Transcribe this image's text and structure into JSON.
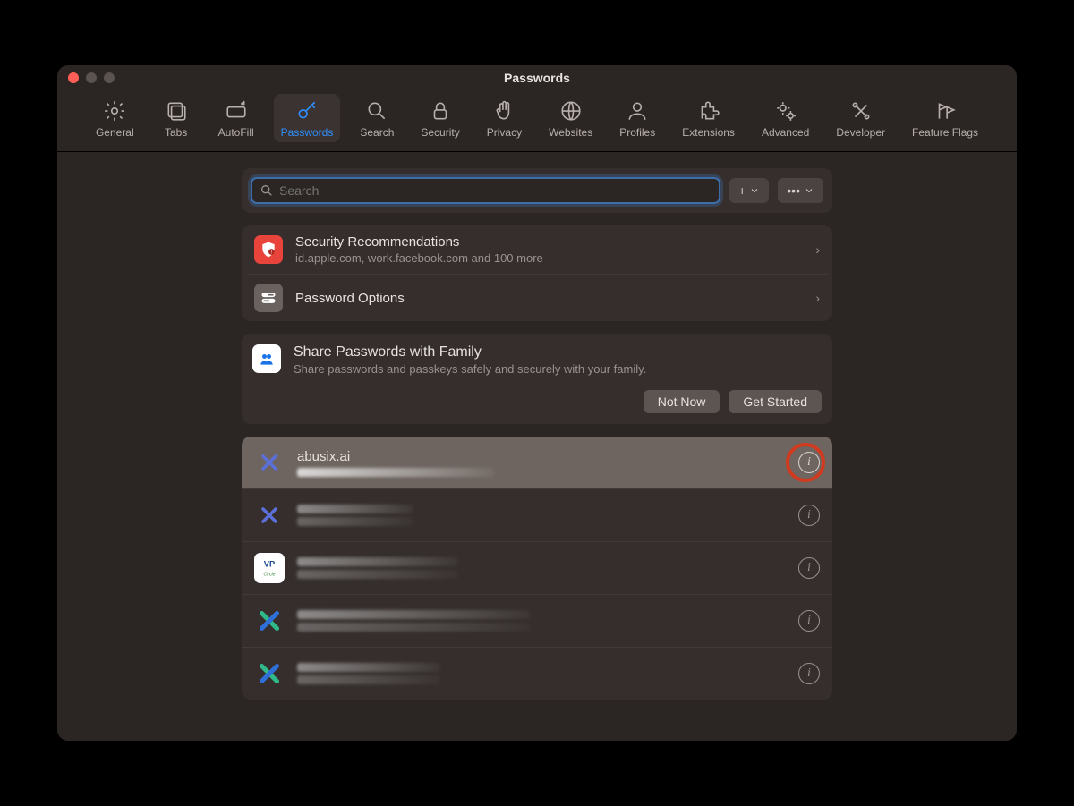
{
  "window": {
    "title": "Passwords"
  },
  "toolbar": {
    "items": [
      {
        "label": "General"
      },
      {
        "label": "Tabs"
      },
      {
        "label": "AutoFill"
      },
      {
        "label": "Passwords"
      },
      {
        "label": "Search"
      },
      {
        "label": "Security"
      },
      {
        "label": "Privacy"
      },
      {
        "label": "Websites"
      },
      {
        "label": "Profiles"
      },
      {
        "label": "Extensions"
      },
      {
        "label": "Advanced"
      },
      {
        "label": "Developer"
      },
      {
        "label": "Feature Flags"
      }
    ],
    "active_index": 3
  },
  "search": {
    "placeholder": "Search",
    "value": ""
  },
  "buttons": {
    "add": "+",
    "more": "•••"
  },
  "sections": {
    "security_recs": {
      "title": "Security Recommendations",
      "subtitle": "id.apple.com, work.facebook.com and 100 more"
    },
    "password_options": {
      "title": "Password Options"
    }
  },
  "share": {
    "title": "Share Passwords with Family",
    "subtitle": "Share passwords and passkeys safely and securely with your family.",
    "not_now": "Not Now",
    "get_started": "Get Started"
  },
  "passwords": [
    {
      "site": "abusix.ai",
      "selected": true,
      "icon": "x-blue"
    },
    {
      "site": "",
      "selected": false,
      "icon": "x-blue"
    },
    {
      "site": "",
      "selected": false,
      "icon": "vp"
    },
    {
      "site": "",
      "selected": false,
      "icon": "x-teal"
    },
    {
      "site": "",
      "selected": false,
      "icon": "x-teal"
    }
  ]
}
